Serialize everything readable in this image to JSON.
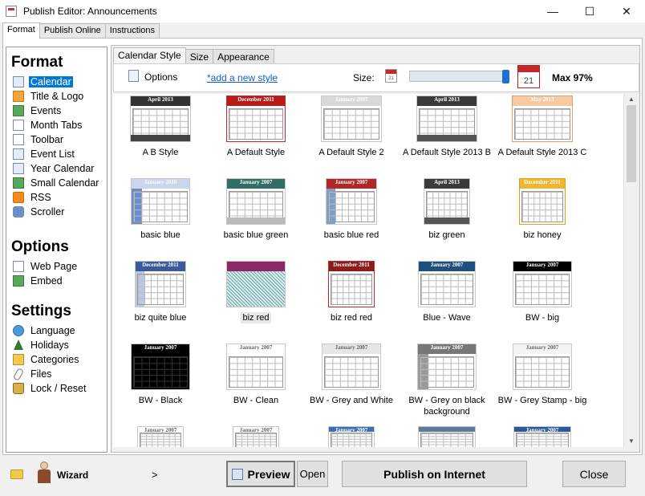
{
  "window": {
    "title": "Publish Editor: Announcements"
  },
  "outer_tabs": [
    {
      "label": "Format",
      "active": true
    },
    {
      "label": "Publish Online",
      "active": false
    },
    {
      "label": "Instructions",
      "active": false
    }
  ],
  "sidebar": {
    "format_heading": "Format",
    "format_items": [
      {
        "label": "Calendar",
        "icon": "calendar-icon",
        "selected": true
      },
      {
        "label": "Title & Logo",
        "icon": "title-logo-icon"
      },
      {
        "label": "Events",
        "icon": "events-icon"
      },
      {
        "label": "Month Tabs",
        "icon": "month-tabs-icon"
      },
      {
        "label": "Toolbar",
        "icon": "toolbar-icon"
      },
      {
        "label": "Event List",
        "icon": "event-list-icon"
      },
      {
        "label": "Year Calendar",
        "icon": "year-calendar-icon"
      },
      {
        "label": "Small Calendar",
        "icon": "small-calendar-icon"
      },
      {
        "label": "RSS",
        "icon": "rss-icon"
      },
      {
        "label": "Scroller",
        "icon": "scroller-icon"
      }
    ],
    "options_heading": "Options",
    "options_items": [
      {
        "label": "Web Page",
        "icon": "web-page-icon"
      },
      {
        "label": "Embed",
        "icon": "embed-icon"
      }
    ],
    "settings_heading": "Settings",
    "settings_items": [
      {
        "label": "Language",
        "icon": "globe-icon"
      },
      {
        "label": "Holidays",
        "icon": "tree-icon"
      },
      {
        "label": "Categories",
        "icon": "categories-icon"
      },
      {
        "label": "Files",
        "icon": "paperclip-icon"
      },
      {
        "label": "Lock / Reset",
        "icon": "lock-icon"
      }
    ]
  },
  "inner_tabs": [
    {
      "label": "Calendar Style",
      "active": true
    },
    {
      "label": "Size",
      "active": false
    },
    {
      "label": "Appearance",
      "active": false
    }
  ],
  "options_bar": {
    "options_label": "Options",
    "add_style_link": "*add a new style",
    "size_label": "Size:",
    "size_value_percent": 97,
    "max_label": "Max 97%",
    "small_cal_label": "21",
    "large_cal_label": "21"
  },
  "styles": [
    {
      "name": "A B Style",
      "header": "April 2013",
      "hdr_color": "#333333",
      "foot_color": "#444444"
    },
    {
      "name": "A Default Style",
      "header": "December 2011",
      "hdr_color": "#b71c1c",
      "border_color": "#c62828"
    },
    {
      "name": "A Default Style 2",
      "header": "January 2007",
      "hdr_color": "#d9d9d9"
    },
    {
      "name": "A Default Style 2013 B",
      "header": "April 2013",
      "hdr_color": "#3a3a3a",
      "foot_color": "#555555"
    },
    {
      "name": "A Default Style 2013 C",
      "header": "May 2013",
      "hdr_color": "#f4c9a4",
      "border_color": "#e3a06a"
    },
    {
      "name": "basic blue",
      "header": "January 2010",
      "hdr_color": "#c9d6ee",
      "side_color": "#6c8ccc"
    },
    {
      "name": "basic blue green",
      "header": "January 2007",
      "hdr_color": "#2f6f66",
      "foot_color": "#bbbbbb"
    },
    {
      "name": "basic blue red",
      "header": "January 2007",
      "hdr_color": "#b32626",
      "side_color": "#7aa0c8"
    },
    {
      "name": "biz green",
      "header": "April 2013",
      "hdr_color": "#3a3a3a",
      "foot_color": "#555555"
    },
    {
      "name": "biz honey",
      "header": "December 2011",
      "hdr_color": "#f2b630",
      "border_color": "#e1a21a"
    },
    {
      "name": "biz quite blue",
      "header": "December 2011",
      "hdr_color": "#3b5a9a",
      "side_color": "#b8c7e6"
    },
    {
      "name": "biz red",
      "header": "",
      "hdr_color": "#8a2a6a",
      "pattern": true,
      "selected": true
    },
    {
      "name": "biz red red",
      "header": "December 2011",
      "hdr_color": "#8e1b1b",
      "border_color": "#c62828"
    },
    {
      "name": "Blue - Wave",
      "header": "January 2007",
      "hdr_color": "#1f4f7e"
    },
    {
      "name": "BW - big",
      "header": "January 2007",
      "hdr_color": "#000000"
    },
    {
      "name": "BW - Black",
      "header": "January 2007",
      "hdr_color": "#000000",
      "dark": true
    },
    {
      "name": "BW - Clean",
      "header": "January 2007",
      "hdr_color": "#ffffff",
      "text_dark": true
    },
    {
      "name": "BW - Grey and White",
      "header": "January 2007",
      "hdr_color": "#e6e6e6",
      "text_dark": true
    },
    {
      "name": "BW - Grey on black background",
      "header": "January 2007",
      "hdr_color": "#777777",
      "side_color": "#9a9a9a"
    },
    {
      "name": "BW - Grey Stamp - big",
      "header": "January 2007",
      "hdr_color": "#f4f4f4",
      "text_dark": true
    },
    {
      "name": "",
      "header": "January 2007",
      "hdr_color": "#ffffff",
      "text_dark": true
    },
    {
      "name": "",
      "header": "January 2007",
      "hdr_color": "#ffffff",
      "text_dark": true
    },
    {
      "name": "",
      "header": "January 2007",
      "hdr_color": "#3a6fb0"
    },
    {
      "name": "",
      "header": "",
      "hdr_color": "#5a7a9a"
    },
    {
      "name": "",
      "header": "January 2007",
      "hdr_color": "#2a5a9a"
    }
  ],
  "footer": {
    "wizard_label": "Wizard",
    "chevron": ">",
    "preview_label": "Preview",
    "open_label": "Open",
    "publish_label": "Publish on Internet",
    "close_label": "Close"
  },
  "window_controls": {
    "minimize": "—",
    "maximize": "☐",
    "close": "✕"
  }
}
